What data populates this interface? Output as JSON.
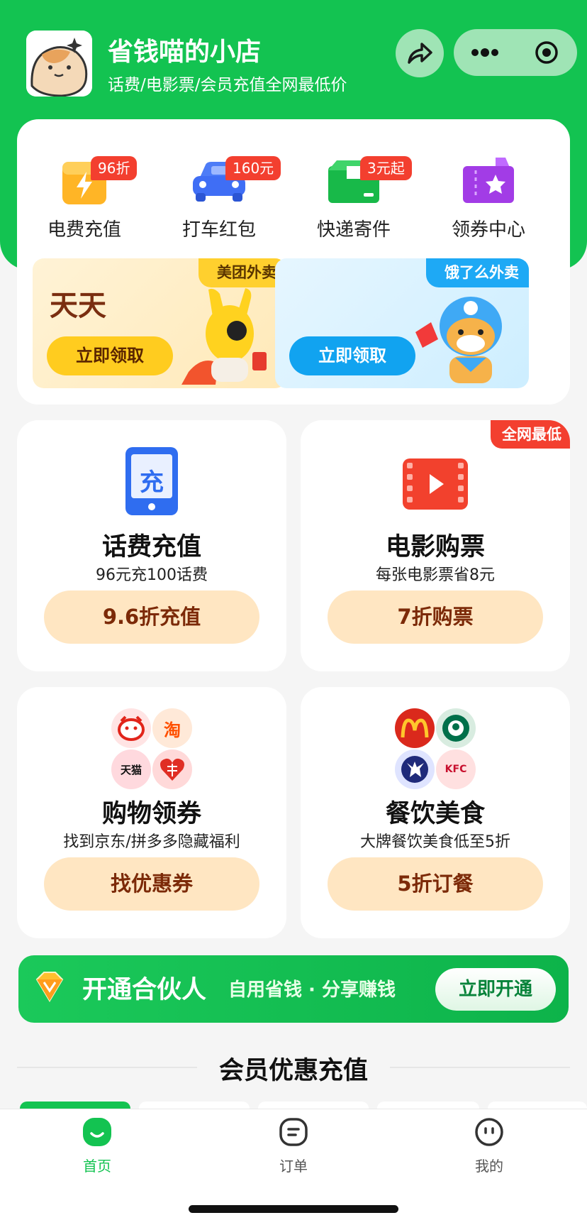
{
  "header": {
    "shop_name": "省钱喵的小店",
    "shop_desc": "话费/电影票/会员充值全网最低价"
  },
  "quick_actions": [
    {
      "label": "电费充值",
      "badge": "96折",
      "icon": "electric-bill-icon"
    },
    {
      "label": "打车红包",
      "badge": "160元",
      "icon": "car-icon"
    },
    {
      "label": "快递寄件",
      "badge": "3元起",
      "icon": "package-icon"
    },
    {
      "label": "领券中心",
      "badge": "",
      "icon": "coupon-star-icon"
    }
  ],
  "promos": [
    {
      "tag": "美团外卖",
      "headline": "天天",
      "claim": "立即领取"
    },
    {
      "tag": "饿了么外卖",
      "claim": "立即领取"
    }
  ],
  "services": [
    {
      "title": "话费充值",
      "sub": "96元充100话费",
      "button": "9.6折充值",
      "icon": "phone-recharge-icon",
      "icon_text": "充"
    },
    {
      "title": "电影购票",
      "sub": "每张电影票省8元",
      "button": "7折购票",
      "icon": "film-ticket-icon",
      "corner": "全网最低"
    },
    {
      "title": "购物领券",
      "sub": "找到京东/拼多多隐藏福利",
      "button": "找优惠券",
      "logos": [
        "jd-logo",
        "淘",
        "天猫",
        "pinduoduo-logo"
      ]
    },
    {
      "title": "餐饮美食",
      "sub": "大牌餐饮美食低至5折",
      "button": "5折订餐",
      "logos": [
        "mcdonalds-logo",
        "starbucks-logo",
        "deer-logo",
        "KFC"
      ]
    }
  ],
  "partner": {
    "title": "开通合伙人",
    "subtitle": "自用省钱 · 分享赚钱",
    "button": "立即开通"
  },
  "section": {
    "title": "会员优惠充值"
  },
  "nav": [
    {
      "label": "首页",
      "icon": "home-icon",
      "active": true
    },
    {
      "label": "订单",
      "icon": "order-icon",
      "active": false
    },
    {
      "label": "我的",
      "icon": "profile-icon",
      "active": false
    }
  ],
  "colors": {
    "brand_green": "#13c351",
    "badge_red": "#f33f2f",
    "button_peach": "#ffe6c2",
    "button_text": "#7c2a08"
  }
}
